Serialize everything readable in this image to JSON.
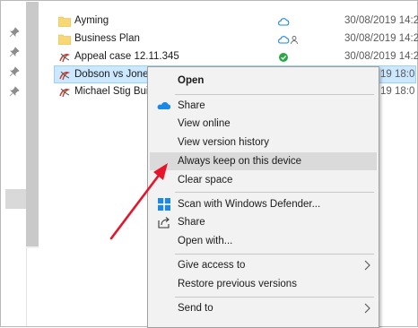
{
  "files": [
    {
      "name": "Ayming",
      "type": "folder",
      "status": "cloud",
      "date": "30/08/2019 14:2"
    },
    {
      "name": "Business Plan",
      "type": "folder",
      "status": "cloud-shared",
      "date": "30/08/2019 14:2"
    },
    {
      "name": "Appeal case 12.11.345",
      "type": "pdf",
      "status": "synced",
      "date": "30/08/2019 14:2"
    },
    {
      "name": "Dobson vs Jones",
      "type": "pdf",
      "status": "",
      "date": "19 18:0"
    },
    {
      "name": "Michael Stig Bui",
      "type": "pdf",
      "status": "",
      "date": "19 18:0"
    }
  ],
  "context_menu": {
    "open": "Open",
    "share_onedrive": "Share",
    "view_online": "View online",
    "view_version_history": "View version history",
    "always_keep": "Always keep on this device",
    "clear_space": "Clear space",
    "scan_defender": "Scan with Windows Defender...",
    "share": "Share",
    "open_with": "Open with...",
    "give_access": "Give access to",
    "restore_versions": "Restore previous versions",
    "send_to": "Send to"
  },
  "colors": {
    "selection": "#cce8ff",
    "menu_bg": "#f2f2f2",
    "menu_highlight": "#dadada",
    "onedrive_blue": "#1e88e5",
    "sync_green": "#27a844",
    "annotation_red": "#e8142a",
    "folder_yellow": "#f8d775"
  }
}
